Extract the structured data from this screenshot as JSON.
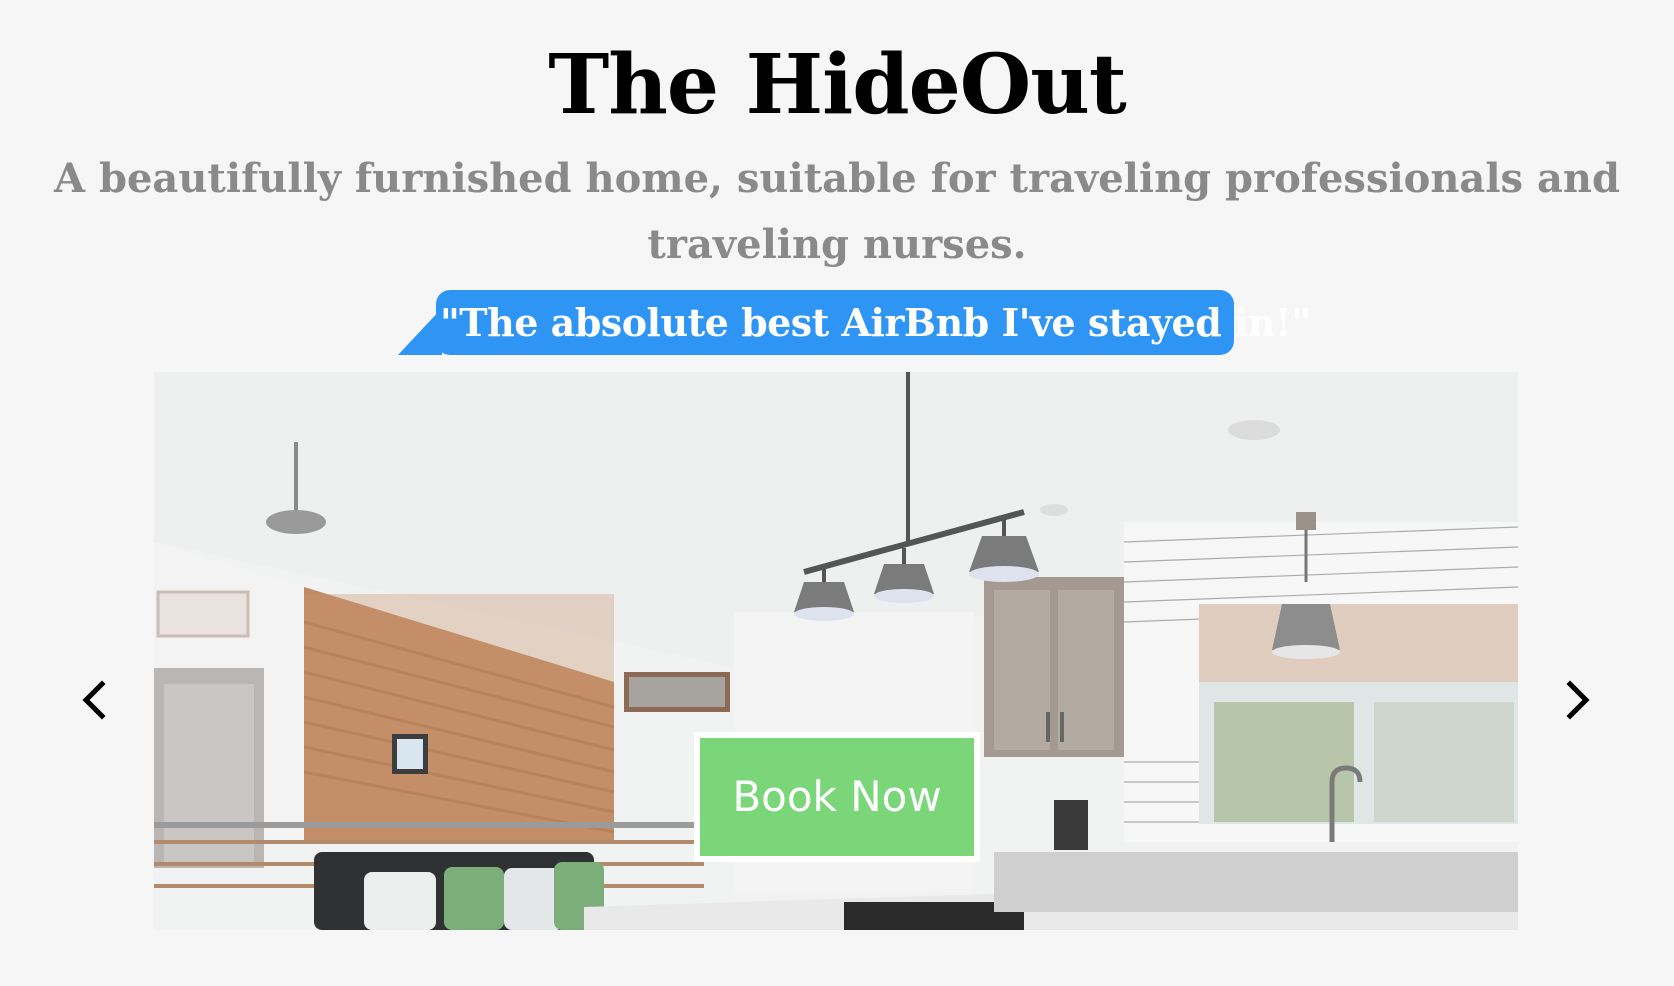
{
  "header": {
    "title": "The HideOut",
    "tagline": "A beautifully furnished home, suitable for traveling professionals and traveling nurses."
  },
  "testimonial": {
    "quote": "\"The absolute best AirBnb I've stayed in!\""
  },
  "carousel": {
    "prev_icon": "chevron-left-icon",
    "next_icon": "chevron-right-icon",
    "slide_description": "kitchen-and-living-room-photo"
  },
  "cta": {
    "label": "Book Now"
  },
  "colors": {
    "background": "#f6f6f6",
    "quote_bubble": "#2f95f5",
    "book_button": "#7bd67a",
    "tagline": "#8a8a8a"
  }
}
